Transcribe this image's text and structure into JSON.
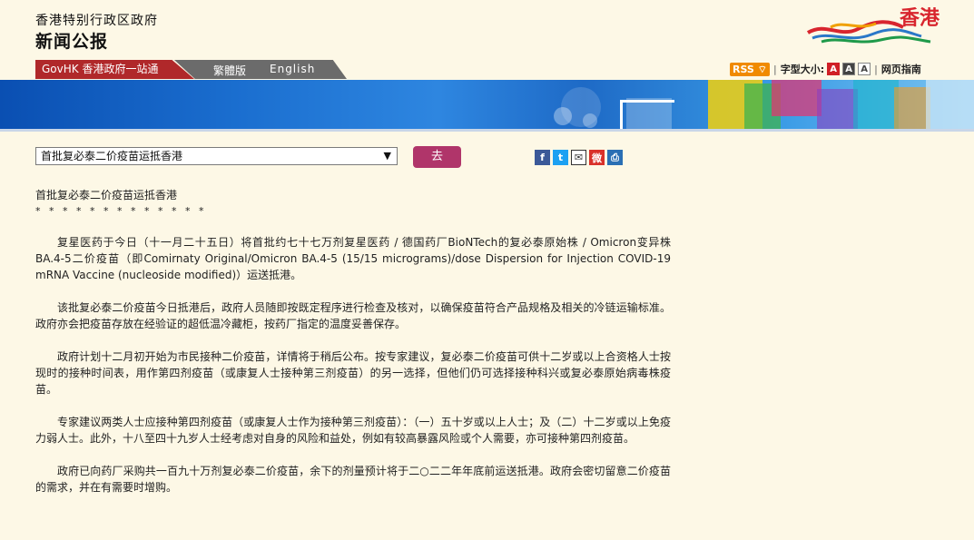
{
  "masthead": {
    "gov_name": "香港特别行政区政府",
    "press_title": "新闻公报",
    "logo_text": "香港"
  },
  "nav": {
    "govhk": "GovHK 香港政府一站通",
    "traditional": "繁體版",
    "english": "English"
  },
  "tools": {
    "rss": "RSS",
    "font_size_label": "字型大小:",
    "sizes": [
      "A",
      "A",
      "A"
    ],
    "guide": "网页指南"
  },
  "controls": {
    "selected_article": "首批复必泰二价疫苗运抵香港",
    "go_label": "去"
  },
  "share_icons": [
    "facebook-icon",
    "twitter-icon",
    "mail-icon",
    "weibo-icon",
    "print-icon"
  ],
  "article": {
    "headline": "首批复必泰二价疫苗运抵香港",
    "stars": "* * * * * * * * * * * * *",
    "paragraphs": [
      "复星医药于今日（十一月二十五日）将首批约七十七万剂复星医药 / 德国药厂BioNTech的复必泰原始株 / Omicron变异株BA.4-5二价疫苗（即Comirnaty Original/Omicron BA.4-5 (15/15 micrograms)/dose Dispersion for Injection COVID-19 mRNA Vaccine (nucleoside modified)）运送抵港。",
      "该批复必泰二价疫苗今日抵港后，政府人员随即按既定程序进行检查及核对，以确保疫苗符合产品规格及相关的冷链运输标准。政府亦会把疫苗存放在经验证的超低温冷藏柜，按药厂指定的温度妥善保存。",
      "政府计划十二月初开始为市民接种二价疫苗，详情将于稍后公布。按专家建议，复必泰二价疫苗可供十二岁或以上合资格人士按现时的接种时间表，用作第四剂疫苗（或康复人士接种第三剂疫苗）的另一选择，但他们仍可选择接种科兴或复必泰原始病毒株疫苗。",
      "专家建议两类人士应接种第四剂疫苗（或康复人士作为接种第三剂疫苗）：（一）五十岁或以上人士；及（二）十二岁或以上免疫力弱人士。此外，十八至四十九岁人士经考虑对自身的风险和益处，例如有较高暴露风险或个人需要，亦可接种第四剂疫苗。",
      "政府已向药厂采购共一百九十万剂复必泰二价疫苗，余下的剂量预计将于二○二二年年底前运送抵港。政府会密切留意二价疫苗的需求，并在有需要时增购。"
    ]
  }
}
